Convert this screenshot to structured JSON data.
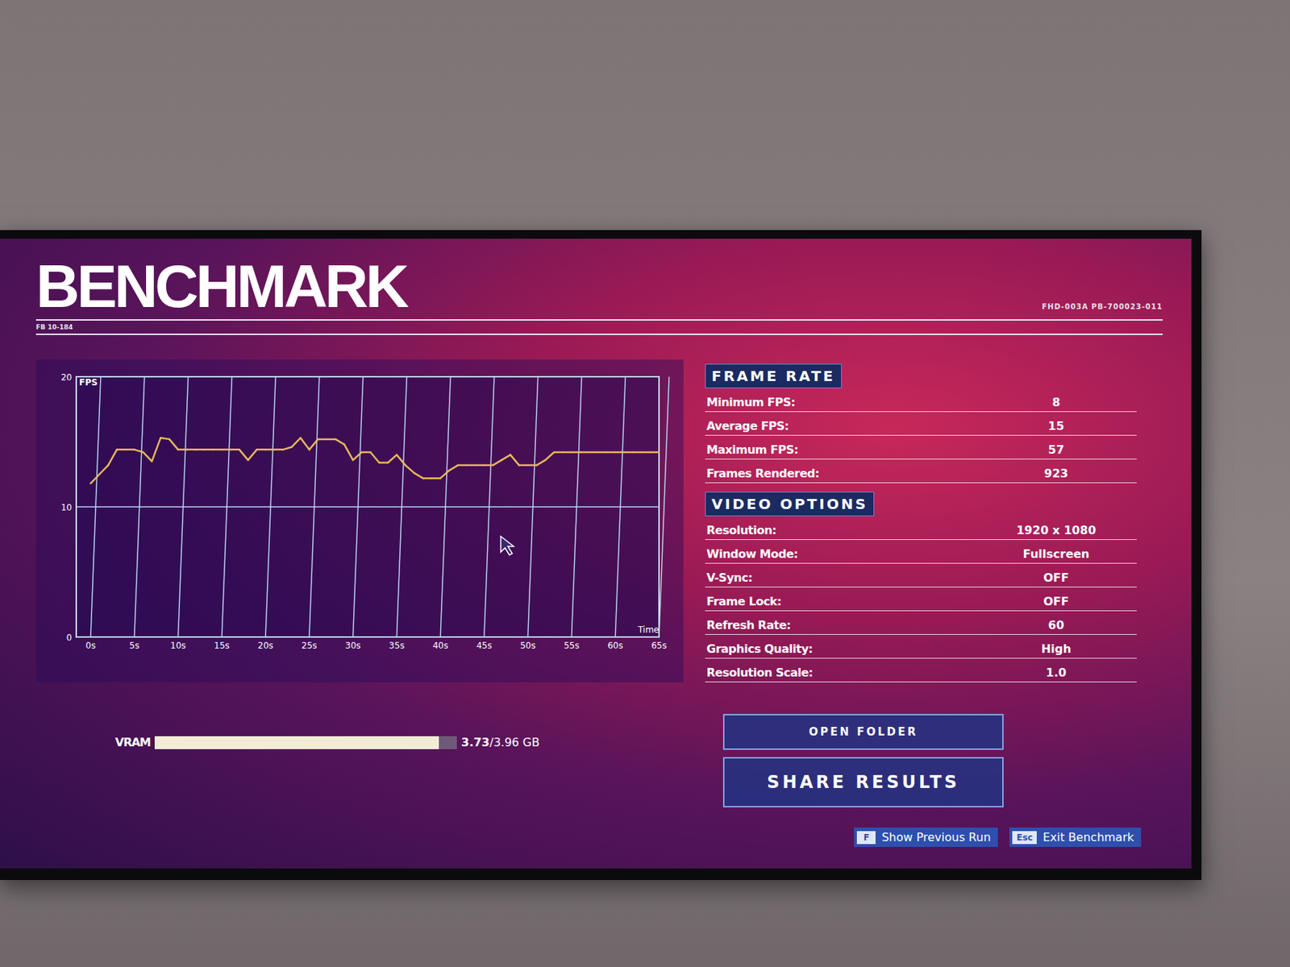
{
  "header": {
    "title": "BENCHMARK",
    "build": "FB 10-184",
    "code": "FHD-003A PB-700023-011"
  },
  "chart": {
    "axis_label": "FPS",
    "time_label": "Time",
    "y_max": 20,
    "y_ticks": [
      "20",
      "10",
      "0"
    ],
    "x_ticks": [
      "0s",
      "5s",
      "10s",
      "15s",
      "20s",
      "25s",
      "30s",
      "35s",
      "40s",
      "45s",
      "50s",
      "55s",
      "60s",
      "65s"
    ],
    "series": [
      {
        "name": "FPS",
        "color": "#e9b85a",
        "values": [
          11.8,
          12.5,
          13.2,
          14.4,
          14.4,
          14.4,
          14.2,
          13.5,
          15.3,
          15.2,
          14.4,
          14.4,
          14.4,
          14.4,
          14.4,
          14.4,
          14.4,
          14.4,
          13.6,
          14.4,
          14.4,
          14.4,
          14.4,
          14.6,
          15.3,
          14.4,
          15.2,
          15.2,
          15.2,
          14.8,
          13.6,
          14.2,
          14.2,
          13.4,
          13.4,
          14.0,
          13.2,
          12.6,
          12.2,
          12.2,
          12.2,
          12.8,
          13.2,
          13.2,
          13.2,
          13.2,
          13.2,
          13.6,
          14.0,
          13.2,
          13.2,
          13.2,
          13.6,
          14.2,
          14.2,
          14.2,
          14.2,
          14.2,
          14.2,
          14.2,
          14.2,
          14.2,
          14.2,
          14.2,
          14.2,
          14.2
        ]
      }
    ]
  },
  "frame_rate": {
    "title": "FRAME RATE",
    "rows": [
      {
        "label": "Minimum FPS:",
        "value": "8"
      },
      {
        "label": "Average FPS:",
        "value": "15"
      },
      {
        "label": "Maximum FPS:",
        "value": "57"
      },
      {
        "label": "Frames Rendered:",
        "value": "923"
      }
    ]
  },
  "video_options": {
    "title": "VIDEO OPTIONS",
    "rows": [
      {
        "label": "Resolution:",
        "value": "1920 x 1080"
      },
      {
        "label": "Window Mode:",
        "value": "Fullscreen"
      },
      {
        "label": "V-Sync:",
        "value": "OFF"
      },
      {
        "label": "Frame Lock:",
        "value": "OFF"
      },
      {
        "label": "Refresh Rate:",
        "value": "60"
      },
      {
        "label": "Graphics Quality:",
        "value": "High"
      },
      {
        "label": "Resolution Scale:",
        "value": "1.0"
      }
    ]
  },
  "vram": {
    "label": "VRAM",
    "used": "3.73",
    "total": "/3.96 GB",
    "level": 0.94
  },
  "buttons": [
    {
      "label": "OPEN FOLDER"
    },
    {
      "label": "SHARE RESULTS"
    }
  ],
  "hints": [
    {
      "key": "F",
      "label": "Show Previous Run"
    },
    {
      "key": "Esc",
      "label": "Exit Benchmark"
    }
  ]
}
